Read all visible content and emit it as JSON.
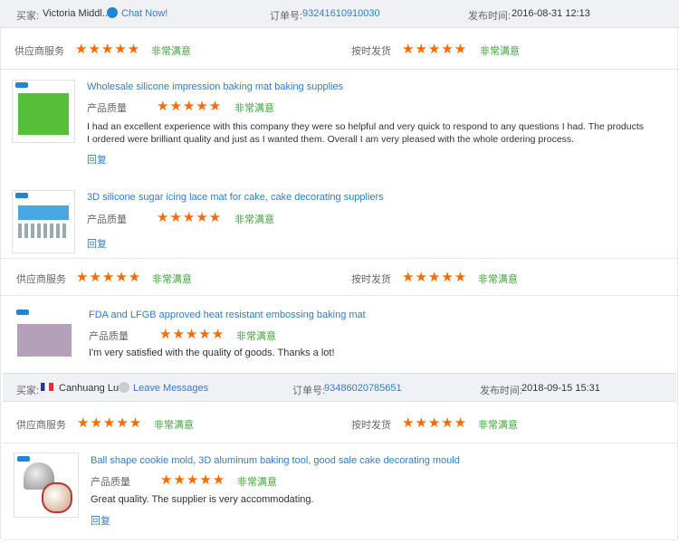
{
  "order1": {
    "buyer_label": "买家:",
    "buyer_name": "Victoria Middl...",
    "chat": "Chat Now!",
    "order_label": "订单号:",
    "order_no": "93241610910030",
    "time_label": "发布时间:",
    "time": "2016-08-31 12:13",
    "supplier_service_label": "供应商服务",
    "supplier_rating": 5,
    "very_satisfied": "非常满意",
    "ontime_label": "按时发货",
    "ontime_rating": 5,
    "products": [
      {
        "title": "Wholesale silicone impression baking mat baking supplies",
        "quality_label": "产品质量",
        "rating": 5,
        "rating_text": "非常满意",
        "review": "I had an excellent experience with this company they were so helpful and very quick to respond to any questions I had. The products I ordered were brilliant quality and just as I wanted them. Overall I am very pleased with the whole ordering process.",
        "reply": "回复"
      },
      {
        "title": "3D silicone sugar icing lace mat for cake, cake decorating suppliers",
        "quality_label": "产品质量",
        "rating": 5,
        "rating_text": "非常满意",
        "reply": "回复"
      }
    ]
  },
  "order1b": {
    "supplier_service_label": "供应商服务",
    "rating_text": "非常满意",
    "ontime_label": "按时发货",
    "product": {
      "title": "FDA and LFGB approved heat resistant embossing baking mat",
      "quality_label": "产品质量",
      "rating_text": "非常满意",
      "review": "I'm very satisfied with the quality of goods. Thanks a lot!"
    }
  },
  "order2": {
    "buyer_label": "买家:",
    "buyer_name": "Canhuang Luo",
    "leave": "Leave Messages",
    "order_label": "订单号:",
    "order_no": "93486020785651",
    "time_label": "发布时间:",
    "time": "2018-09-15 15:31",
    "supplier_service_label": "供应商服务",
    "rating_text": "非常满意",
    "ontime_label": "按时发货",
    "product": {
      "title": "Ball shape cookie mold, 3D aluminum baking tool, good sale cake decorating mould",
      "quality_label": "产品质量",
      "rating_text": "非常满意",
      "review": "Great quality. The supplier is very accommodating.",
      "reply": "回复"
    }
  },
  "stars": "★★★★★",
  "colors": {
    "accent": "#2f7dd1",
    "star": "#ff6a00",
    "satisfied": "#3fa33a",
    "header_bg": "#eff1f5"
  }
}
